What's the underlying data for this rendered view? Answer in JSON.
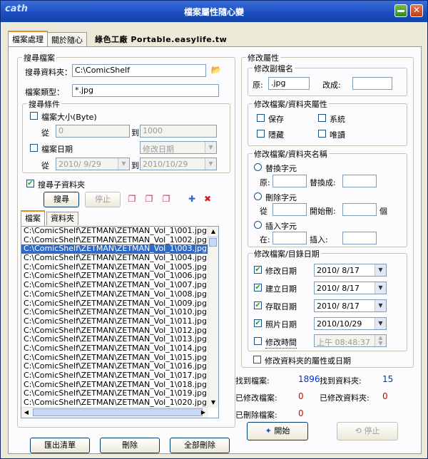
{
  "window": {
    "title": "檔案屬性隨心變",
    "logo": "cath"
  },
  "tabs": [
    "檔案處理",
    "關於隨心"
  ],
  "brand": "綠色工廠 Portable.easylife.tw",
  "search": {
    "legend": "搜尋檔案",
    "folder_label": "搜尋資料夾：",
    "folder_value": "C:\\ComicShelf",
    "type_label": "檔案類型：",
    "type_value": "*.jpg",
    "cond_legend": "搜尋條件",
    "size_label": "檔案大小(Byte)",
    "from_label": "從",
    "to_label": "到",
    "size_from": "0",
    "size_to": "1000",
    "date_label": "檔案日期",
    "date_type": "修改日期",
    "date_from": "2010/  9/29",
    "date_to": "2010/10/29",
    "subfolder_label": "搜尋子資料夾",
    "search_button": "搜尋",
    "stop_button": "停止"
  },
  "list_tabs": [
    "檔案",
    "資料夾"
  ],
  "files": [
    "C:\\ComicShelf\\ZETMAN\\ZETMAN_Vol_1\\001.jpg",
    "C:\\ComicShelf\\ZETMAN\\ZETMAN_Vol_1\\002.jpg",
    "C:\\ComicShelf\\ZETMAN\\ZETMAN_Vol_1\\003.jpg",
    "C:\\ComicShelf\\ZETMAN\\ZETMAN_Vol_1\\004.jpg",
    "C:\\ComicShelf\\ZETMAN\\ZETMAN_Vol_1\\005.jpg",
    "C:\\ComicShelf\\ZETMAN\\ZETMAN_Vol_1\\006.jpg",
    "C:\\ComicShelf\\ZETMAN\\ZETMAN_Vol_1\\007.jpg",
    "C:\\ComicShelf\\ZETMAN\\ZETMAN_Vol_1\\008.jpg",
    "C:\\ComicShelf\\ZETMAN\\ZETMAN_Vol_1\\009.jpg",
    "C:\\ComicShelf\\ZETMAN\\ZETMAN_Vol_1\\010.jpg",
    "C:\\ComicShelf\\ZETMAN\\ZETMAN_Vol_1\\011.jpg",
    "C:\\ComicShelf\\ZETMAN\\ZETMAN_Vol_1\\012.jpg",
    "C:\\ComicShelf\\ZETMAN\\ZETMAN_Vol_1\\013.jpg",
    "C:\\ComicShelf\\ZETMAN\\ZETMAN_Vol_1\\014.jpg",
    "C:\\ComicShelf\\ZETMAN\\ZETMAN_Vol_1\\015.jpg",
    "C:\\ComicShelf\\ZETMAN\\ZETMAN_Vol_1\\016.jpg",
    "C:\\ComicShelf\\ZETMAN\\ZETMAN_Vol_1\\017.jpg",
    "C:\\ComicShelf\\ZETMAN\\ZETMAN_Vol_1\\018.jpg",
    "C:\\ComicShelf\\ZETMAN\\ZETMAN_Vol_1\\019.jpg",
    "C:\\ComicShelf\\ZETMAN\\ZETMAN_Vol_1\\020.jpg"
  ],
  "selected_index": 2,
  "bottom_buttons": {
    "export": "匯出清單",
    "remove": "刪除",
    "remove_all": "全部刪除"
  },
  "modify": {
    "legend": "修改屬性",
    "ext_legend": "修改副檔名",
    "orig_label": "原:",
    "orig_value": ".jpg",
    "new_label": "改成:",
    "new_value": "",
    "attr_legend": "修改檔案/資料夾屬性",
    "attr_items": [
      "保存",
      "系統",
      "隱藏",
      "唯讀"
    ],
    "name_legend": "修改檔案/資料夾名稱",
    "replace_label": "替換字元",
    "replace_orig": "原:",
    "replace_to": "替換成:",
    "delete_label": "刪除字元",
    "delete_from": "從",
    "delete_start": "開始刪:",
    "delete_unit": "個",
    "insert_label": "插入字元",
    "insert_at": "在:",
    "insert_text": "插入:",
    "date_legend": "修改檔案/目錄日期",
    "dates": [
      {
        "label": "修改日期",
        "value": "2010/  8/17"
      },
      {
        "label": "建立日期",
        "value": "2010/  8/17"
      },
      {
        "label": "存取日期",
        "value": "2010/  8/17"
      },
      {
        "label": "照片日期",
        "value": "2010/10/29"
      }
    ],
    "time_label": "修改時間",
    "time_value": "上午 08:48:37",
    "folder_attr_label": "修改資料夾的屬性或日期"
  },
  "stats": {
    "found_files_label": "找到檔案:",
    "found_files": "1896",
    "found_folders_label": "找到資料夾:",
    "found_folders": "15",
    "mod_files_label": "已修改檔案:",
    "mod_files": "0",
    "mod_folders_label": "已修改資料夾:",
    "mod_folders": "0",
    "del_files_label": "已刪除檔案:",
    "del_files": "0"
  },
  "actions": {
    "start": "開始",
    "stop": "停止"
  }
}
